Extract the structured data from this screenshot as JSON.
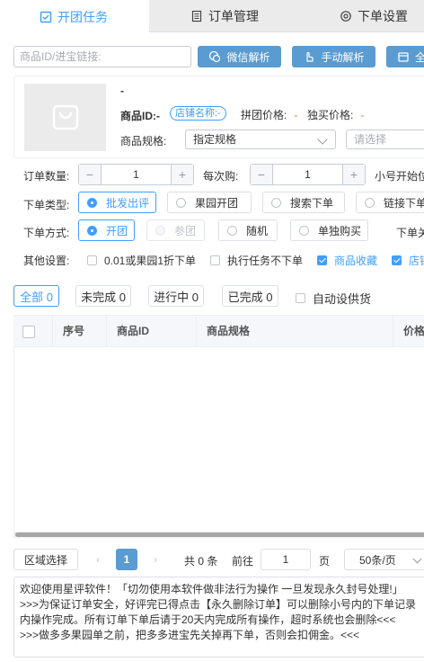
{
  "tabs": [
    {
      "label": "开团任务",
      "icon": "checkbox-icon",
      "active": true
    },
    {
      "label": "订单管理",
      "icon": "document-list-icon",
      "active": false
    },
    {
      "label": "下单设置",
      "icon": "settings-icon",
      "active": false
    }
  ],
  "search": {
    "placeholder": "商品ID/进宝链接:"
  },
  "toolbar": {
    "wechat_parse": "微信解析",
    "manual_parse": "手动解析",
    "third": "全"
  },
  "product": {
    "title": "-",
    "id_label": "商品ID:",
    "id_value": "-",
    "shop_tag": "店铺名称:-",
    "group_price_label": "拼团价格:",
    "group_price_value": "-",
    "solo_price_label": "独买价格:",
    "solo_price_value": "-",
    "spec_label": "商品规格:",
    "spec_value": "指定规格",
    "spec_select_placeholder": "请选择"
  },
  "form": {
    "order_qty_label": "订单数量:",
    "order_qty_value": "1",
    "each_buy_label": "每次购:",
    "each_buy_value": "1",
    "start_label": "小号开始位",
    "order_type_label": "下单类型:",
    "order_types": [
      {
        "label": "批发出评",
        "selected": true,
        "disabled": false
      },
      {
        "label": "果园开团",
        "selected": false,
        "disabled": false
      },
      {
        "label": "搜索下单",
        "selected": false,
        "disabled": false
      },
      {
        "label": "链接下单",
        "selected": false,
        "disabled": false
      }
    ],
    "order_method_label": "下单方式:",
    "order_methods": [
      {
        "label": "开团",
        "selected": true,
        "disabled": false
      },
      {
        "label": "参团",
        "selected": false,
        "disabled": true
      },
      {
        "label": "随机",
        "selected": false,
        "disabled": false
      },
      {
        "label": "单独购买",
        "selected": false,
        "disabled": false
      }
    ],
    "order_method_tail": "下单关",
    "other_label": "其他设置:",
    "other_options": [
      {
        "label": "0.01或果园1折下单",
        "checked": false
      },
      {
        "label": "执行任务不下单",
        "checked": false
      },
      {
        "label": "商品收藏",
        "checked": true
      },
      {
        "label": "店铺",
        "checked": true
      }
    ]
  },
  "filters": [
    {
      "label": "全部 0",
      "active": true
    },
    {
      "label": "未完成 0",
      "active": false
    },
    {
      "label": "进行中 0",
      "active": false
    },
    {
      "label": "已完成 0",
      "active": false
    }
  ],
  "auto_supply_label": "自动设供货",
  "table": {
    "columns": [
      "序号",
      "商品ID",
      "商品规格",
      "价格"
    ]
  },
  "pager": {
    "region_select": "区域选择",
    "current_page": "1",
    "total": "共 0 条",
    "goto_label": "前往",
    "goto_value": "1",
    "page_unit": "页",
    "page_size": "50条/页"
  },
  "notice": [
    "欢迎使用星评软件！「切勿使用本软件做非法行为操作 一旦发现永久封号处理!」",
    ">>>为保证订单安全，好评完已得点击【永久删除订单】可以删除小号内的下单记录",
    "内操作完成。所有订单下单后请于20天内完成所有操作，超时系统也会删除<<<",
    ">>>做多多果园单之前，把多多进宝先关掉再下单，否则会扣佣金。<<<"
  ]
}
